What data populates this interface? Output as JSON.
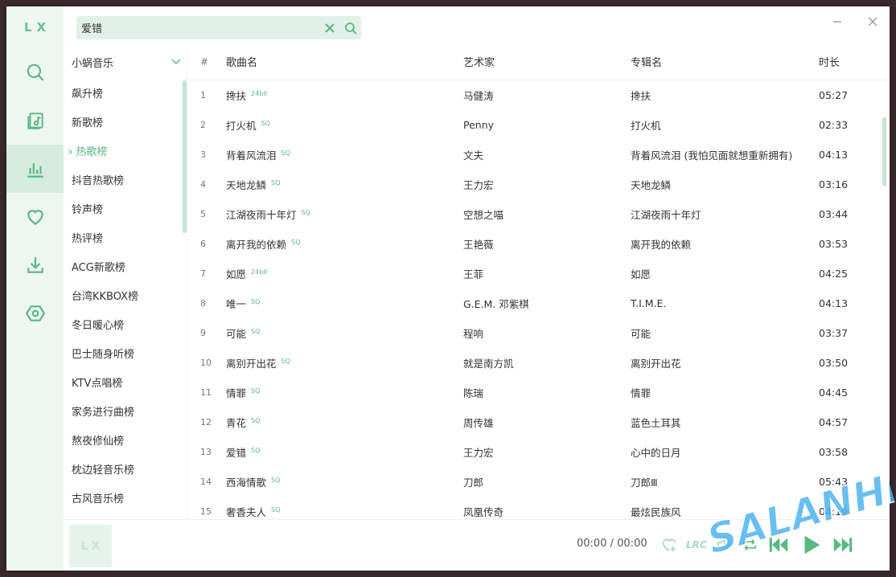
{
  "app": {
    "logo": "LX"
  },
  "search": {
    "value": "爱错",
    "placeholder": ""
  },
  "nav": [
    "search",
    "my-songs",
    "leaderboard",
    "favorites",
    "download",
    "settings"
  ],
  "source": {
    "label": "小蜗音乐"
  },
  "boards": [
    "飙升榜",
    "新歌榜",
    "热歌榜",
    "抖音热歌榜",
    "铃声榜",
    "热评榜",
    "ACG新歌榜",
    "台湾KKBOX榜",
    "冬日暖心榜",
    "巴士随身听榜",
    "KTV点唱榜",
    "家务进行曲榜",
    "熬夜修仙榜",
    "枕边轻音乐榜",
    "古风音乐榜"
  ],
  "table": {
    "headers": {
      "num": "#",
      "name": "歌曲名",
      "artist": "艺术家",
      "album": "专辑名",
      "duration": "时长"
    },
    "rows": [
      {
        "num": "1",
        "name": "搀扶",
        "quality": "24bit",
        "artist": "马健涛",
        "album": "搀扶",
        "duration": "05:27"
      },
      {
        "num": "2",
        "name": "打火机",
        "quality": "SQ",
        "artist": "Penny",
        "album": "打火机",
        "duration": "02:33"
      },
      {
        "num": "3",
        "name": "背着风流泪",
        "quality": "SQ",
        "artist": "文夫",
        "album": "背着风流泪 (我怕见面就想重新拥有)",
        "duration": "04:13"
      },
      {
        "num": "4",
        "name": "天地龙鳞",
        "quality": "SQ",
        "artist": "王力宏",
        "album": "天地龙鳞",
        "duration": "03:16"
      },
      {
        "num": "5",
        "name": "江湖夜雨十年灯",
        "quality": "SQ",
        "artist": "空想之喵",
        "album": "江湖夜雨十年灯",
        "duration": "03:44"
      },
      {
        "num": "6",
        "name": "离开我的依赖",
        "quality": "SQ",
        "artist": "王艳薇",
        "album": "离开我的依赖",
        "duration": "03:53"
      },
      {
        "num": "7",
        "name": "如愿",
        "quality": "24bit",
        "artist": "王菲",
        "album": "如愿",
        "duration": "04:25"
      },
      {
        "num": "8",
        "name": "唯一",
        "quality": "SQ",
        "artist": "G.E.M. 邓紫棋",
        "album": "T.I.M.E.",
        "duration": "04:13"
      },
      {
        "num": "9",
        "name": "可能",
        "quality": "SQ",
        "artist": "程响",
        "album": "可能",
        "duration": "03:37"
      },
      {
        "num": "10",
        "name": "离别开出花",
        "quality": "SQ",
        "artist": "就是南方凯",
        "album": "离别开出花",
        "duration": "03:50"
      },
      {
        "num": "11",
        "name": "情罪",
        "quality": "SQ",
        "artist": "陈瑞",
        "album": "情罪",
        "duration": "04:45"
      },
      {
        "num": "12",
        "name": "青花",
        "quality": "SQ",
        "artist": "周传雄",
        "album": "蓝色土耳其",
        "duration": "04:57"
      },
      {
        "num": "13",
        "name": "爱错",
        "quality": "SQ",
        "artist": "王力宏",
        "album": "心中的日月",
        "duration": "03:58"
      },
      {
        "num": "14",
        "name": "西海情歌",
        "quality": "SQ",
        "artist": "刀郎",
        "album": "刀郎Ⅲ",
        "duration": "05:43"
      },
      {
        "num": "15",
        "name": "奢香夫人",
        "quality": "SQ",
        "artist": "凤凰传奇",
        "album": "最炫民族风",
        "duration": "04:19"
      }
    ]
  },
  "player": {
    "cover_text": "LX",
    "current": "00:00",
    "separator": "/",
    "total": "00:00",
    "lrc_label": "LRC"
  },
  "watermark": "SALANHE",
  "colors": {
    "accent": "#5ab883",
    "rail": "#eef6f1",
    "search_bg": "#e1f1e7",
    "active_nav": "#d5ebde"
  }
}
